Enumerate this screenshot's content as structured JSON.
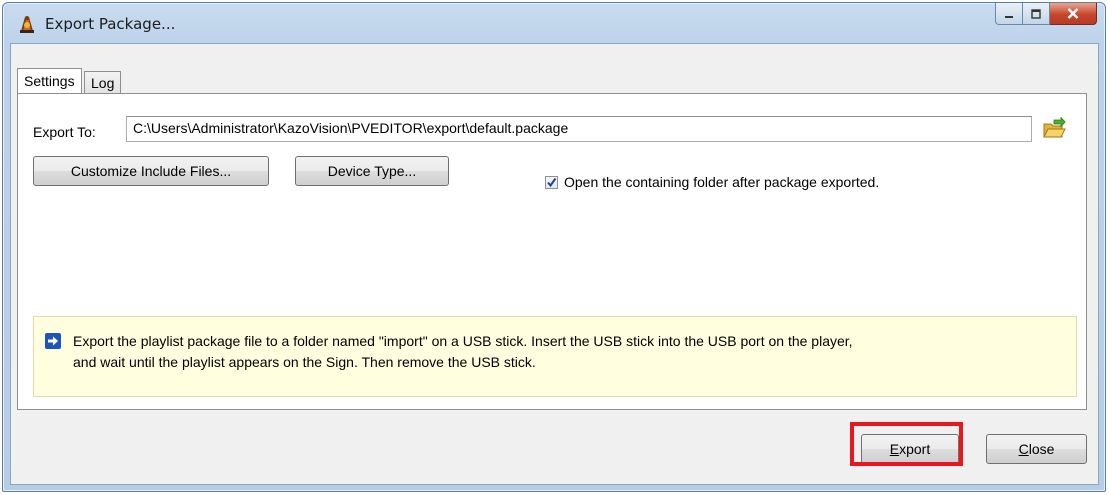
{
  "window": {
    "title": "Export Package..."
  },
  "tabs": [
    {
      "label": "Settings",
      "active": true
    },
    {
      "label": "Log",
      "active": false
    }
  ],
  "settings": {
    "export_to_label": "Export To:",
    "export_to_value": "C:\\Users\\Administrator\\KazoVision\\PVEDITOR\\export\\default.package",
    "customize_button": "Customize Include Files...",
    "device_type_button": "Device Type...",
    "open_folder_checkbox": {
      "label": "Open the containing folder after package exported.",
      "checked": true
    }
  },
  "info": {
    "line1": "Export the playlist package file to a folder named \"import\" on a USB stick. Insert the USB stick into the USB port on the player,",
    "line2": "and wait until the playlist appears on the Sign. Then remove the USB stick."
  },
  "footer": {
    "export_mnemonic": "E",
    "export_rest": "xport",
    "close_mnemonic": "C",
    "close_rest": "lose"
  },
  "colors": {
    "highlight": "#e8171f",
    "info_background": "#ffffe0",
    "titlebar": "#bdd3ea",
    "close_button": "#c7462c"
  },
  "icons": {
    "app": "app-icon",
    "browse": "open-folder-icon",
    "info": "arrow-right-icon"
  }
}
